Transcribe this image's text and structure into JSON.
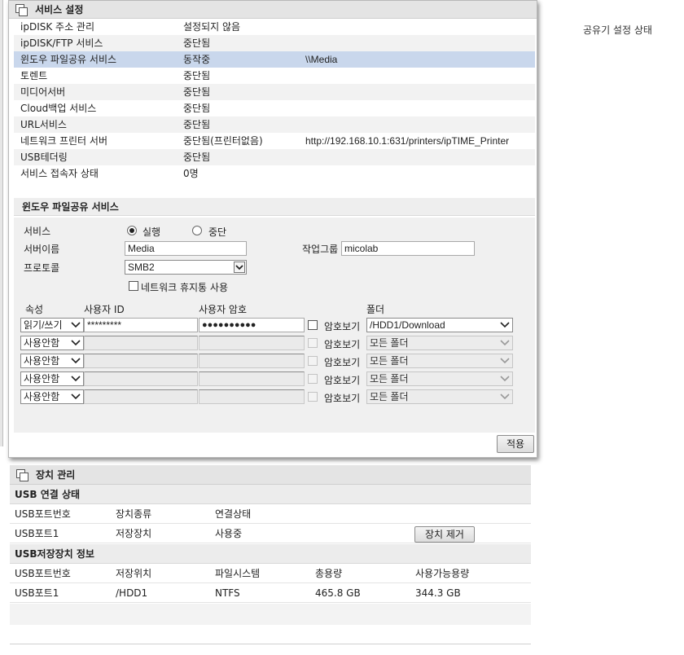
{
  "right_status": "공유기 설정 상태",
  "service_panel": {
    "title": "서비스 설정",
    "rows": [
      {
        "name": "ipDISK 주소 관리",
        "status": "설정되지 않음",
        "detail": ""
      },
      {
        "name": "ipDISK/FTP 서비스",
        "status": "중단됨",
        "detail": ""
      },
      {
        "name": "윈도우 파일공유 서비스",
        "status": "동작중",
        "detail": "\\\\Media"
      },
      {
        "name": "토렌트",
        "status": "중단됨",
        "detail": ""
      },
      {
        "name": "미디어서버",
        "status": "중단됨",
        "detail": ""
      },
      {
        "name": "Cloud백업 서비스",
        "status": "중단됨",
        "detail": ""
      },
      {
        "name": "URL서비스",
        "status": "중단됨",
        "detail": ""
      },
      {
        "name": "네트워크 프린터 서버",
        "status": "중단됨(프린터없음)",
        "detail": "http://192.168.10.1:631/printers/ipTIME_Printer"
      },
      {
        "name": "USB테더링",
        "status": "중단됨",
        "detail": ""
      },
      {
        "name": "서비스 접속자 상태",
        "status": "0명",
        "detail": ""
      }
    ]
  },
  "smb_form": {
    "section_title": "윈도우 파일공유 서비스",
    "service_label": "서비스",
    "run_label": "실행",
    "stop_label": "중단",
    "server_name_label": "서버이름",
    "server_name_value": "Media",
    "workgroup_label": "작업그룹",
    "workgroup_value": "micolab",
    "protocol_label": "프로토콜",
    "protocol_value": "SMB2",
    "recycle_label": "네트워크 휴지통 사용",
    "col_attr": "속성",
    "col_user": "사용자 ID",
    "col_pass": "사용자 암호",
    "col_folder": "폴더",
    "show_pw_label": "암호보기",
    "accounts": [
      {
        "attr": "읽기/쓰기",
        "user": "*********",
        "pass": "●●●●●●●●●●",
        "folder": "/HDD1/Download",
        "enabled": true
      },
      {
        "attr": "사용안함",
        "user": "",
        "pass": "",
        "folder": "모든 폴더",
        "enabled": false
      },
      {
        "attr": "사용안함",
        "user": "",
        "pass": "",
        "folder": "모든 폴더",
        "enabled": false
      },
      {
        "attr": "사용안함",
        "user": "",
        "pass": "",
        "folder": "모든 폴더",
        "enabled": false
      },
      {
        "attr": "사용안함",
        "user": "",
        "pass": "",
        "folder": "모든 폴더",
        "enabled": false
      }
    ],
    "apply_label": "적용"
  },
  "device_panel": {
    "title": "장치 관리",
    "usb_status_title": "USB 연결 상태",
    "usb_status_headers": [
      "USB포트번호",
      "장치종류",
      "연결상태"
    ],
    "usb_status_row": [
      "USB포트1",
      "저장장치",
      "사용중"
    ],
    "remove_label": "장치 제거",
    "storage_title": "USB저장장치 정보",
    "storage_headers": [
      "USB포트번호",
      "저장위치",
      "파일시스템",
      "총용량",
      "사용가능용량"
    ],
    "storage_row": [
      "USB포트1",
      "/HDD1",
      "NTFS",
      "465.8 GB",
      "344.3 GB"
    ]
  }
}
